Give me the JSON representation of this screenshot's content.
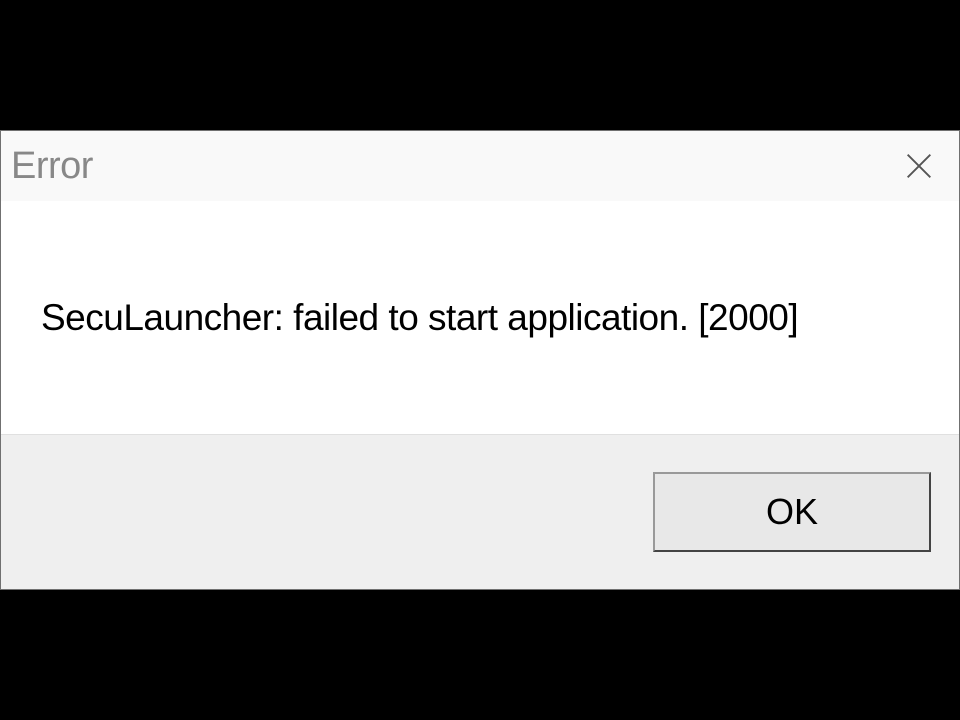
{
  "dialog": {
    "title": "Error",
    "message": "SecuLauncher: failed to start application. [2000]",
    "ok_label": "OK"
  }
}
